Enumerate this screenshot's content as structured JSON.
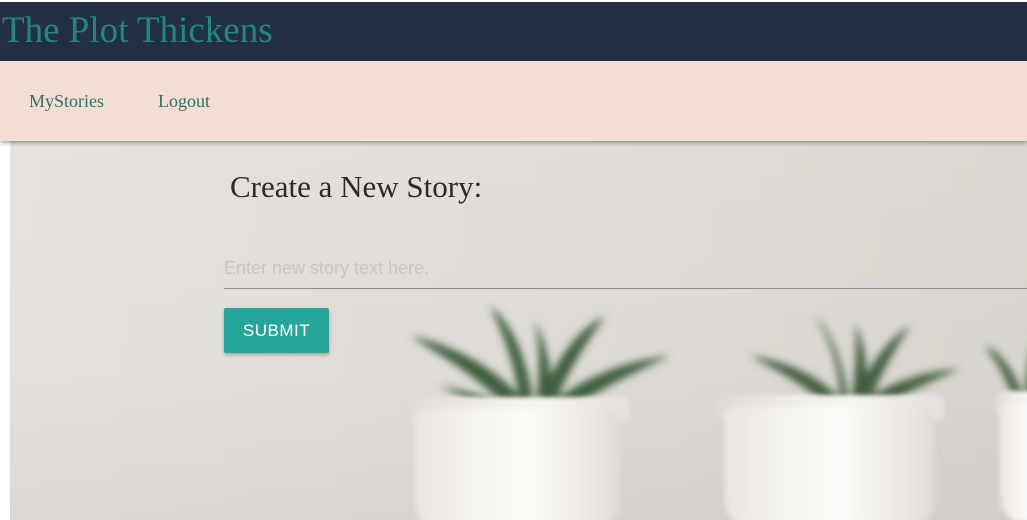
{
  "app": {
    "title": "The Plot Thickens"
  },
  "nav": {
    "items": [
      {
        "label": "MyStories"
      },
      {
        "label": "Logout"
      }
    ]
  },
  "main": {
    "heading": "Create a New Story:",
    "story_input": {
      "placeholder": "Enter new story text here.",
      "value": ""
    },
    "submit_label": "SUBMIT"
  },
  "colors": {
    "header_bg": "#232f42",
    "brand_text": "#22897a",
    "nav_bg": "#f2ded2",
    "nav_link": "#2f6f67",
    "button_bg": "#26a69a",
    "button_text": "#ffffff"
  },
  "background_image": {
    "subject": "blurred succulent plants in white pots"
  }
}
